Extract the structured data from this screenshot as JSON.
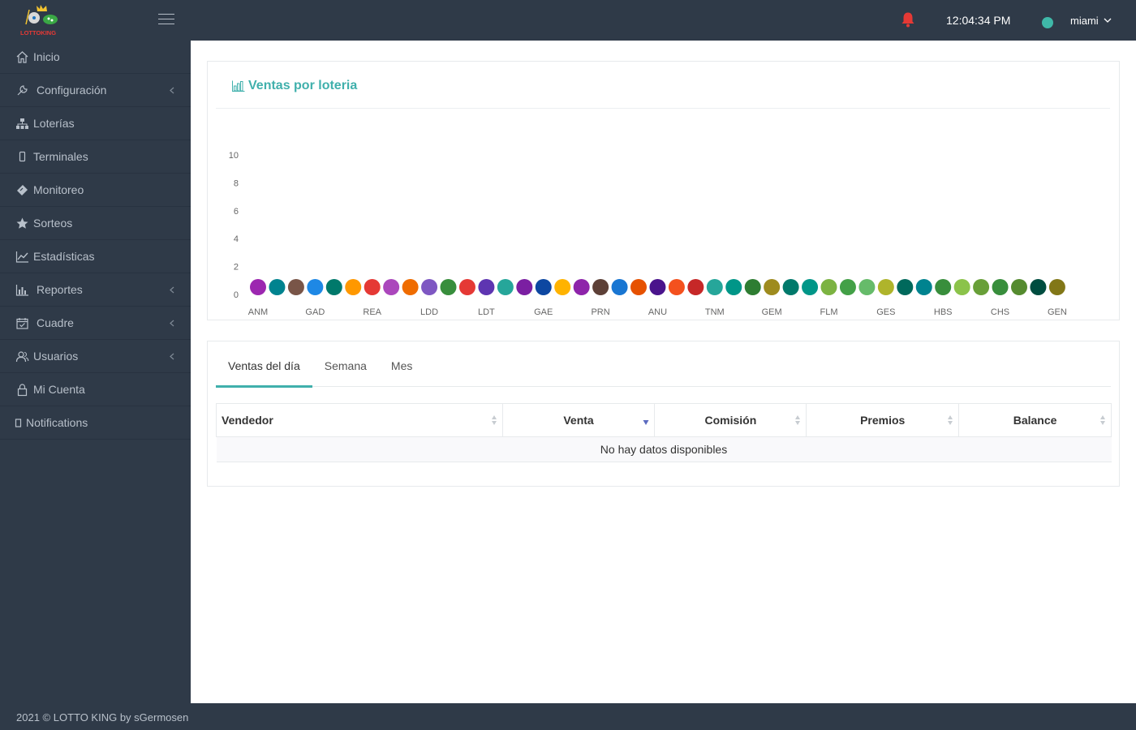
{
  "app": {
    "logo_text": "LOTTOKING",
    "clock": "12:04:34 PM",
    "user": "miami",
    "colors": {
      "sidebar": "#2f3a48",
      "accent": "#40b0ac",
      "bell": "#e53935",
      "status": "#3fb8a8"
    }
  },
  "sidebar": {
    "items": [
      {
        "label": "Inicio",
        "icon": "home-icon",
        "has_chevron": false
      },
      {
        "label": "Configuración",
        "icon": "wrench-icon",
        "has_chevron": true
      },
      {
        "label": "Loterías",
        "icon": "sitemap-icon",
        "has_chevron": false
      },
      {
        "label": "Terminales",
        "icon": "mobile-icon",
        "has_chevron": false
      },
      {
        "label": "Monitoreo",
        "icon": "ticket-icon",
        "has_chevron": false
      },
      {
        "label": "Sorteos",
        "icon": "star-icon",
        "has_chevron": false
      },
      {
        "label": "Estadísticas",
        "icon": "line-chart-icon",
        "has_chevron": false
      },
      {
        "label": "Reportes",
        "icon": "bar-chart-icon",
        "has_chevron": true
      },
      {
        "label": "Cuadre",
        "icon": "calendar-check-icon",
        "has_chevron": true
      },
      {
        "label": "Usuarios",
        "icon": "users-icon",
        "has_chevron": true
      },
      {
        "label": "Mi Cuenta",
        "icon": "lock-icon",
        "has_chevron": false
      },
      {
        "label": "Notifications",
        "icon": "square-icon",
        "has_chevron": false
      }
    ]
  },
  "footer": {
    "text": "2021 © LOTTO KING by sGermosen"
  },
  "chart_panel": {
    "title": "Ventas por loteria"
  },
  "chart_data": {
    "type": "scatter",
    "title": "Ventas por loteria",
    "xlabel": "",
    "ylabel": "",
    "ylim": [
      0,
      10
    ],
    "yticks": [
      0,
      2,
      4,
      6,
      8,
      10
    ],
    "labeled_categories": [
      "ANM",
      "GAD",
      "REA",
      "LDD",
      "LDT",
      "GAE",
      "PRN",
      "ANU",
      "TNM",
      "GEM",
      "FLM",
      "GES",
      "HBS",
      "CHS",
      "GEN"
    ],
    "point_count": 43,
    "values": [
      0,
      0,
      0,
      0,
      0,
      0,
      0,
      0,
      0,
      0,
      0,
      0,
      0,
      0,
      0,
      0,
      0,
      0,
      0,
      0,
      0,
      0,
      0,
      0,
      0,
      0,
      0,
      0,
      0,
      0,
      0,
      0,
      0,
      0,
      0,
      0,
      0,
      0,
      0,
      0,
      0,
      0,
      0
    ],
    "colors": [
      "#9c27b0",
      "#00838f",
      "#795548",
      "#1e88e5",
      "#00796b",
      "#ff9800",
      "#e53935",
      "#ab47bc",
      "#ef6c00",
      "#7e57c2",
      "#388e3c",
      "#e53935",
      "#5e35b1",
      "#26a69a",
      "#7b1fa2",
      "#0d47a1",
      "#ffb300",
      "#8e24aa",
      "#5d4037",
      "#1976d2",
      "#e65100",
      "#4a148c",
      "#f4511e",
      "#c62828",
      "#26a69a",
      "#009688",
      "#2e7d32",
      "#9e8b1e",
      "#00796b",
      "#009688",
      "#7cb342",
      "#43a047",
      "#66bb6a",
      "#afb42b",
      "#00695c",
      "#00838f",
      "#388e3c",
      "#8bc34a",
      "#689f38",
      "#388e3c",
      "#558b2f",
      "#004d40",
      "#827717"
    ]
  },
  "tabs": [
    "Ventas del día",
    "Semana",
    "Mes"
  ],
  "table": {
    "columns": [
      "Vendedor",
      "Venta",
      "Comisión",
      "Premios",
      "Balance"
    ],
    "empty_message": "No hay datos disponibles"
  }
}
